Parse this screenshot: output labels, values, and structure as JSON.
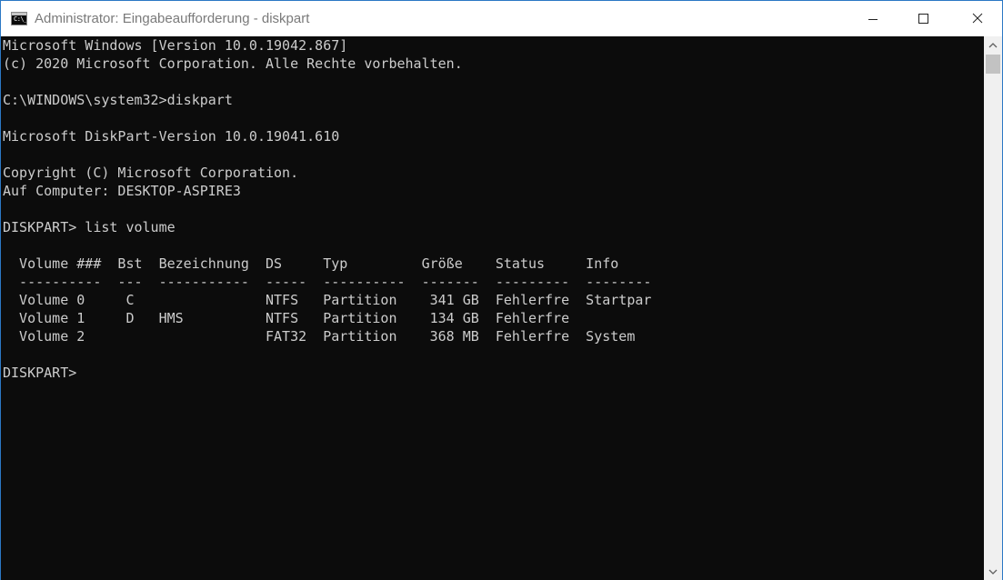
{
  "window": {
    "title": "Administrator: Eingabeaufforderung - diskpart",
    "icon_glyph": "C:\\_",
    "icon": "cmd-icon",
    "controls": [
      "minimize-icon",
      "maximize-icon",
      "close-icon"
    ]
  },
  "console": {
    "lines": [
      "Microsoft Windows [Version 10.0.19042.867]",
      "(c) 2020 Microsoft Corporation. Alle Rechte vorbehalten.",
      "",
      "C:\\WINDOWS\\system32>diskpart",
      "",
      "Microsoft DiskPart-Version 10.0.19041.610",
      "",
      "Copyright (C) Microsoft Corporation.",
      "Auf Computer: DESKTOP-ASPIRE3",
      "",
      "DISKPART> list volume",
      "",
      "  Volume ###  Bst  Bezeichnung  DS     Typ         Größe    Status     Info",
      "  ----------  ---  -----------  -----  ----------  -------  ---------  --------",
      "  Volume 0     C                NTFS   Partition    341 GB  Fehlerfre  Startpar",
      "  Volume 1     D   HMS          NTFS   Partition    134 GB  Fehlerfre",
      "  Volume 2                      FAT32  Partition    368 MB  Fehlerfre  System",
      "",
      "DISKPART> "
    ]
  },
  "colors": {
    "console_bg": "#0c0c0c",
    "console_fg": "#cccccc",
    "title_text": "#7a7a7a",
    "window_border": "#2b78c5"
  }
}
